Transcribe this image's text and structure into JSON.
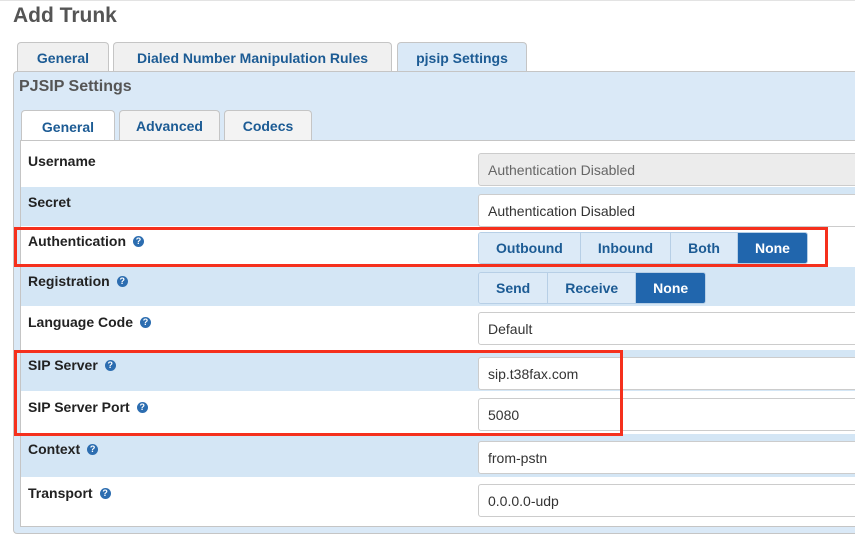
{
  "page_title": "Add Trunk",
  "tabs": [
    {
      "label": "General"
    },
    {
      "label": "Dialed Number Manipulation Rules"
    },
    {
      "label": "pjsip Settings"
    }
  ],
  "section_title": "PJSIP Settings",
  "subtabs": [
    {
      "label": "General"
    },
    {
      "label": "Advanced"
    },
    {
      "label": "Codecs"
    }
  ],
  "help_glyph": "?",
  "fields": {
    "username": {
      "label": "Username",
      "value": "Authentication Disabled"
    },
    "secret": {
      "label": "Secret",
      "value": "Authentication Disabled"
    },
    "authentication": {
      "label": "Authentication",
      "options": [
        "Outbound",
        "Inbound",
        "Both",
        "None"
      ],
      "selected": "None"
    },
    "registration": {
      "label": "Registration",
      "options": [
        "Send",
        "Receive",
        "None"
      ],
      "selected": "None"
    },
    "language_code": {
      "label": "Language Code",
      "value": "Default"
    },
    "sip_server": {
      "label": "SIP Server",
      "value": "sip.t38fax.com"
    },
    "sip_server_port": {
      "label": "SIP Server Port",
      "value": "5080"
    },
    "context": {
      "label": "Context",
      "value": "from-pstn"
    },
    "transport": {
      "label": "Transport",
      "value": "0.0.0.0-udp"
    }
  },
  "colors": {
    "accent": "#2166ad",
    "highlight_box": "#f5301d",
    "row_alt": "#d4e6f5"
  }
}
